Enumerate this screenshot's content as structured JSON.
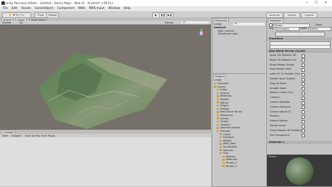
{
  "window": {
    "title": "Unity Personal (64bit) - Untitled - Demo Maps - Web Gl - Android* <DX11>",
    "minimize": "—",
    "maximize": "☐",
    "close": "✕"
  },
  "menu": [
    "File",
    "Edit",
    "Assets",
    "GameObject",
    "Component",
    "RWS",
    "RWS Input",
    "Window",
    "Help"
  ],
  "toolbar": {
    "pivot": "Pivot",
    "global": "Global",
    "play": "▶",
    "pause": "❚❚",
    "step": "▶❚",
    "account": "Account",
    "layers": "Layers",
    "layout": "Layout"
  },
  "scene": {
    "tabs": [
      "Scene",
      "Game",
      "Asset Store"
    ],
    "shaded": "Shaded",
    "mode_2d": "2D",
    "gizmos": "Gizmos",
    "search_placeholder": "All"
  },
  "hierarchy": {
    "tab": "Hierarchy",
    "create": "Create",
    "search_placeholder": "All",
    "items": [
      "Untitled*",
      "Main Camera",
      "Directional Light"
    ]
  },
  "project": {
    "tab": "Project",
    "create": "Create",
    "items": [
      "Favorites",
      "Assets",
      "Editor",
      "Gizmos",
      "Materials",
      "Models",
      "Nature",
      "Plugins",
      "Prefabs",
      "Real World Terrain",
      "Resources",
      "Scenes",
      "Scripts",
      "Shaders",
      "Standard Assets",
      "Textures",
      "Cache",
      "Elevation",
      "Models",
      "RWS_Data",
      "TerrainData",
      "Textures",
      "Tiles",
      "Meshes",
      "Materials",
      "Terrain_1",
      "Terrain_2"
    ]
  },
  "console": {
    "tab": "Console",
    "buttons": [
      "Clear",
      "Collapse",
      "Clear on Play",
      "Error Pause"
    ]
  },
  "inspector": {
    "tab": "Inspector",
    "name": "Terrain",
    "static": "Static",
    "tag": "Untagged",
    "layer": "Default",
    "transform": "Transform",
    "component": "Real World Terrain (Script)",
    "rows": [
      "Allow Tile Markers 3D",
      "Allow Tile Markers 2D",
      "Show Marker Tooltip",
      "Drag Marker Hold",
      "Label On Or Double Click",
      "Double Touch Enable",
      "Drag To Zoom",
      "Smooth Zoom",
      "Zoom In Zoom Out",
      "Camera",
      "Camera Rotation",
      "Camera Distance",
      "Camera Adjust To",
      "Markers",
      "Default Marker",
      "Marker Scale",
      "Check Marker 3D Visibility",
      "Add Component"
    ],
    "material": "Materials 1",
    "preview_label": "Terrain"
  },
  "colors": {
    "scene_bg": "#76706b",
    "terrain": "#5f7d58",
    "panel": "#c6c6c6"
  }
}
